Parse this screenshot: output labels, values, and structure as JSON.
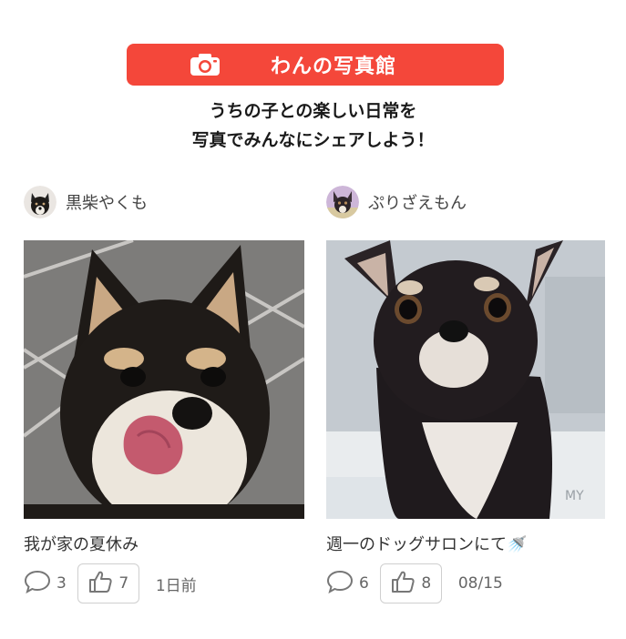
{
  "header": {
    "title": "わんの写真館",
    "camera_icon": "camera-icon",
    "subtitle_line1": "うちの子との楽しい日常を",
    "subtitle_line2": "写真でみんなにシェアしよう！",
    "accent_color": "#f4473a"
  },
  "posts": [
    {
      "user": "黒柴やくも",
      "caption": "我が家の夏休み",
      "comments": "3",
      "likes": "7",
      "date": "1日前"
    },
    {
      "user": "ぷりざえもん",
      "caption": "週一のドッグサロンにて🚿",
      "comments": "6",
      "likes": "8",
      "date": "08/15"
    }
  ]
}
